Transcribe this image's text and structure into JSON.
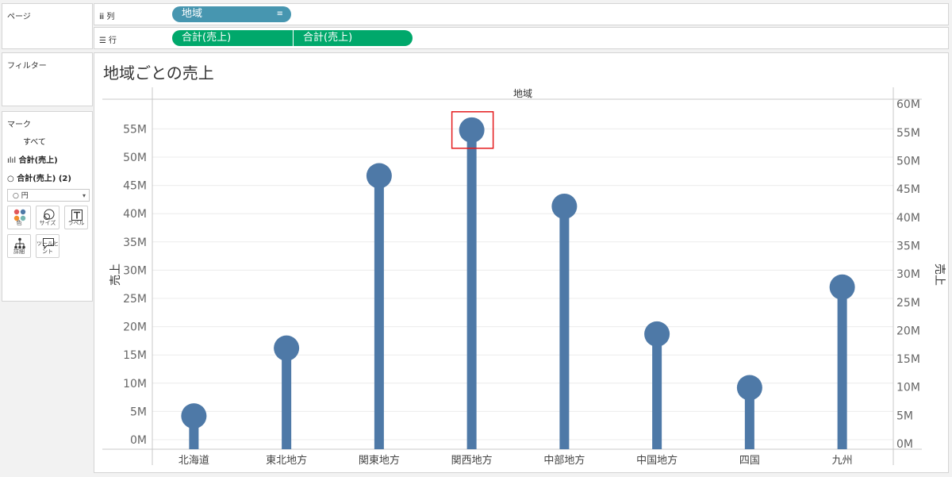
{
  "sidebar": {
    "pages_title": "ページ",
    "filters_title": "フィルター",
    "marks_title": "マーク",
    "marks_all": "すべて",
    "marks_bar_row": "合計(売上)",
    "marks_circle_row": "合計(売上) (2)",
    "mark_type": "円",
    "buttons": {
      "color": "色",
      "size": "サイズ",
      "label": "ラベル",
      "detail": "詳細",
      "tooltip": "ツールヒント"
    }
  },
  "shelves": {
    "columns_label": "列",
    "rows_label": "行",
    "columns_pill": "地域",
    "rows_pill_1": "合計(売上)",
    "rows_pill_2": "合計(売上)"
  },
  "colors": {
    "mark": "#4e79a7",
    "highlight": "#e41a1c",
    "pill_blue": "#4796b0",
    "pill_green": "#00a86b"
  },
  "chart_data": {
    "type": "bar",
    "title": "地域ごとの売上",
    "xlabel": "地域",
    "ylabel": "売上",
    "y2label": "売上",
    "categories": [
      "北海道",
      "東北地方",
      "関東地方",
      "関西地方",
      "中部地方",
      "中国地方",
      "四国",
      "九州"
    ],
    "values": [
      4.2,
      16.2,
      46.7,
      54.8,
      41.3,
      18.7,
      9.2,
      27.0
    ],
    "unit": "M",
    "ylim_left": [
      0,
      58
    ],
    "ylim_right": [
      0,
      60
    ],
    "yticks_left": [
      0,
      5,
      10,
      15,
      20,
      25,
      30,
      35,
      40,
      45,
      50,
      55
    ],
    "yticks_right": [
      0,
      5,
      10,
      15,
      20,
      25,
      30,
      35,
      40,
      45,
      50,
      55,
      60
    ],
    "highlighted_category": "関西地方",
    "grid": true
  }
}
